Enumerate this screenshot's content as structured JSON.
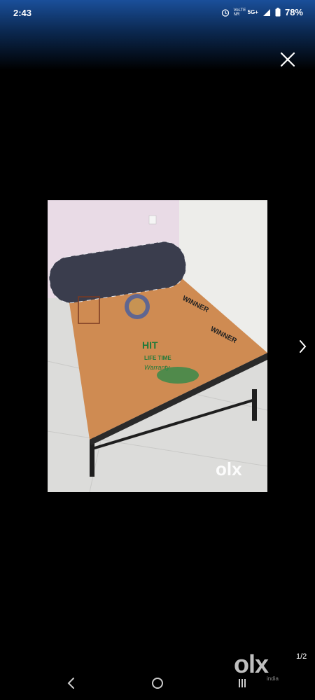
{
  "status": {
    "time": "2:43",
    "network_1": "VoLTE NR",
    "network_2": "5G+",
    "battery": "78%"
  },
  "viewer": {
    "page_indicator": "1/2",
    "watermark_logo": "olx",
    "watermark_sub": "india",
    "photo_watermark": "olx"
  },
  "photo": {
    "board_brand_1": "WINNER",
    "board_brand_2": "WINNER",
    "board_text_1": "HIT",
    "board_text_2": "LIFE TIME",
    "board_text_3": "Warranty"
  },
  "icons": {
    "close": "close-icon",
    "next": "chevron-right-icon",
    "back": "back-icon",
    "home": "home-icon",
    "recents": "recents-icon"
  }
}
